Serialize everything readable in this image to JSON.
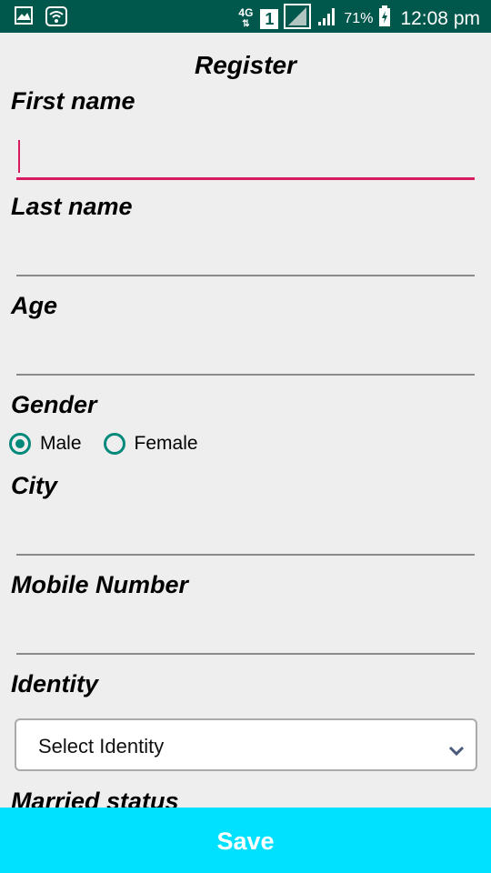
{
  "status_bar": {
    "network_type": "4G",
    "sim_slot": "1",
    "battery_percent": "71%",
    "time": "12:08 pm",
    "icons": [
      "gallery-icon",
      "wifi-icon",
      "sim-icon",
      "signal-icon",
      "battery-charging-icon"
    ]
  },
  "form": {
    "title": "Register",
    "first_name_label": "First name",
    "first_name_value": "",
    "last_name_label": "Last name",
    "last_name_value": "",
    "age_label": "Age",
    "age_value": "",
    "gender_label": "Gender",
    "gender_options": [
      "Male",
      "Female"
    ],
    "gender_selected": "Male",
    "city_label": "City",
    "city_value": "",
    "mobile_label": "Mobile Number",
    "mobile_value": "",
    "identity_label": "Identity",
    "identity_selected": "Select Identity",
    "married_label": "Married status",
    "save_label": "Save"
  },
  "colors": {
    "status_bar": "#00574b",
    "accent_focus": "#d81b60",
    "radio": "#00897b",
    "save_button": "#00e1ff",
    "background": "#eeeeee"
  }
}
